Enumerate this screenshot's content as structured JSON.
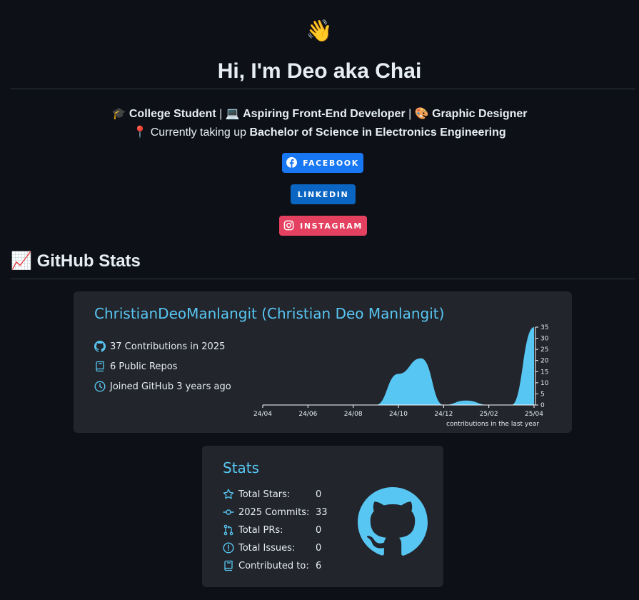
{
  "header": {
    "wave_emoji": "👋",
    "title": "Hi, I'm Deo aka Chai"
  },
  "intro": {
    "line1": [
      {
        "emoji": "🎓",
        "text": "College Student"
      },
      {
        "sep": "|"
      },
      {
        "emoji": "💻",
        "text": "Aspiring Front-End Developer"
      },
      {
        "sep": "|"
      },
      {
        "emoji": "🎨",
        "text": "Graphic Designer"
      }
    ],
    "line2_emoji": "📍",
    "line2_prefix": "Currently taking up",
    "line2_bold": "Bachelor of Science in Electronics Engineering"
  },
  "badges": {
    "facebook": {
      "label": "FACEBOOK",
      "color": "#1877f2",
      "icon": "facebook-icon"
    },
    "linkedin": {
      "label": "LINKEDIN",
      "color": "#0a66c2"
    },
    "instagram": {
      "label": "INSTAGRAM",
      "color": "#e4405f",
      "icon": "instagram-icon"
    }
  },
  "github_section": {
    "emoji": "📈",
    "heading": "GitHub Stats"
  },
  "profile_card": {
    "title": "ChristianDeoManlangit (Christian Deo Manlangit)",
    "rows": [
      {
        "icon": "github-icon",
        "text": "37 Contributions in 2025"
      },
      {
        "icon": "repo-icon",
        "text": "6 Public Repos"
      },
      {
        "icon": "clock-icon",
        "text": "Joined GitHub 3 years ago"
      }
    ],
    "accent": "#58c6f3",
    "background": "#22252b"
  },
  "chart_data": {
    "type": "area",
    "x": [
      "24/04",
      "24/05",
      "24/06",
      "24/07",
      "24/08",
      "24/09",
      "24/10",
      "24/11",
      "24/12",
      "25/01",
      "25/02",
      "25/03",
      "25/04"
    ],
    "values": [
      0,
      0,
      0,
      0,
      0,
      0,
      14,
      21,
      0,
      2,
      0,
      0,
      36
    ],
    "xticks": [
      "24/04",
      "24/06",
      "24/08",
      "24/10",
      "24/12",
      "25/02",
      "25/04"
    ],
    "yticks": [
      0,
      5,
      10,
      15,
      20,
      25,
      30,
      35
    ],
    "ylim": [
      0,
      35
    ],
    "caption": "contributions in the last year",
    "color": "#58c6f3"
  },
  "stats_card": {
    "title": "Stats",
    "items": [
      {
        "icon": "star-icon",
        "label": "Total Stars:",
        "value": "0"
      },
      {
        "icon": "commit-icon",
        "label": "2025 Commits:",
        "value": "33"
      },
      {
        "icon": "pull-request-icon",
        "label": "Total PRs:",
        "value": "0"
      },
      {
        "icon": "issue-icon",
        "label": "Total Issues:",
        "value": "0"
      },
      {
        "icon": "repo-icon",
        "label": "Contributed to:",
        "value": "6"
      }
    ],
    "logo": "github-octocat-icon"
  }
}
